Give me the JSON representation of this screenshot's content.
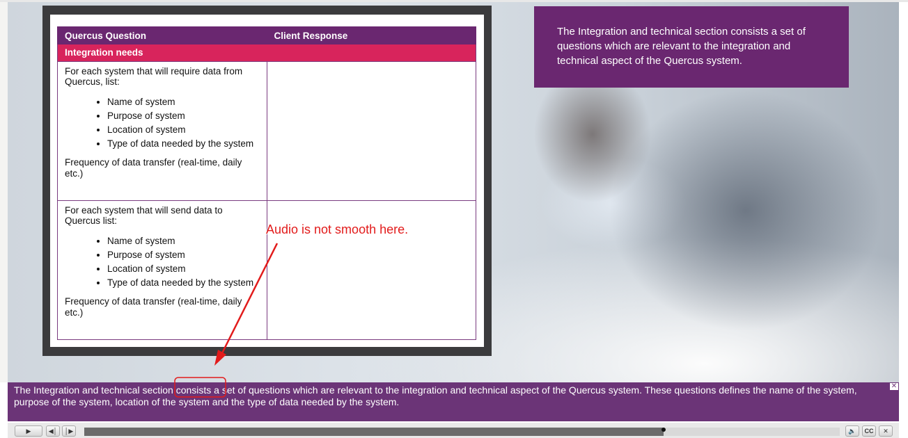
{
  "slide": {
    "table": {
      "headers": {
        "question": "Quercus Question",
        "response": "Client Response"
      },
      "section": "Integration needs",
      "rows": [
        {
          "intro": "For each system that will require data from Quercus, list:",
          "items": [
            "Name of system",
            "Purpose of system",
            "Location of system",
            "Type of data needed by the system"
          ],
          "frequency": "Frequency of data transfer (real-time, daily etc.)",
          "response": ""
        },
        {
          "intro": "For each system that will send data to Quercus list:",
          "items": [
            "Name of system",
            "Purpose of system",
            "Location of system",
            "Type of data needed by the system"
          ],
          "frequency": "Frequency of data transfer (real-time, daily etc.)",
          "response": ""
        }
      ]
    },
    "info_text": "The Integration and technical section consists a set of questions which are relevant to the integration and technical aspect of the Quercus system."
  },
  "caption": {
    "before": "The Integration and technical section ",
    "highlight": "consists a",
    "after": " set of questions which are relevant to the integration and technical aspect of the Quercus system. These questions defines the name of the system, purpose of the system, location of the system and the type of data needed by the system.",
    "close_icon": "close-icon"
  },
  "annotation": {
    "text": "Audio is not smooth here.",
    "color": "#e21b1b"
  },
  "player": {
    "progress": 0.767,
    "buttons": [
      "play-icon",
      "previous-icon",
      "next-icon",
      "volume-icon",
      "closed-captions-icon",
      "close-icon"
    ],
    "cc_label": "CC",
    "accent": "#6b3477"
  }
}
